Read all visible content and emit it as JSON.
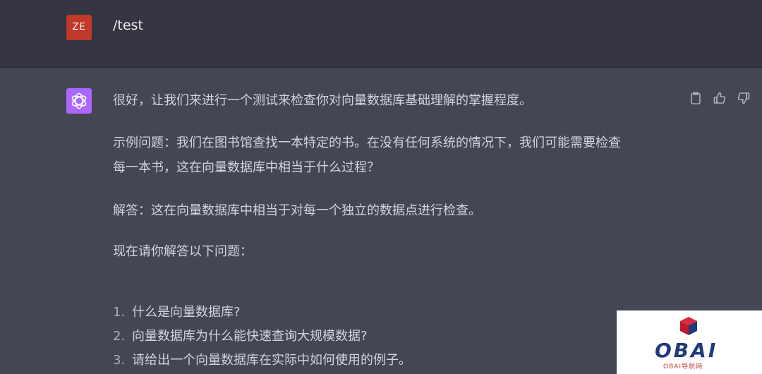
{
  "user_message": {
    "avatar_initials": "ZE",
    "avatar_color": "#c0392b",
    "text": "/test"
  },
  "assistant_message": {
    "avatar_icon": "openai-logo-icon",
    "avatar_color": "#ab68ff",
    "paragraphs": [
      "很好，让我们来进行一个测试来检查你对向量数据库基础理解的掌握程度。",
      "示例问题：我们在图书馆查找一本特定的书。在没有任何系统的情况下，我们可能需要检查\n每一本书，这在向量数据库中相当于什么过程？",
      "解答：这在向量数据库中相当于对每一个独立的数据点进行检查。",
      "现在请你解答以下问题："
    ],
    "list": [
      {
        "num": "1.",
        "text": "什么是向量数据库?"
      },
      {
        "num": "2.",
        "text": "向量数据库为什么能快速查询大规模数据?"
      },
      {
        "num": "3.",
        "text": "请给出一个向量数据库在实际中如何使用的例子。"
      }
    ],
    "actions": [
      "clipboard-icon",
      "thumbs-up-icon",
      "thumbs-down-icon"
    ]
  },
  "watermark": {
    "title": "OBAI",
    "subtitle": "OBAI导航网"
  },
  "colors": {
    "user_bg": "#343541",
    "assistant_bg": "#444654",
    "text": "#d1d5db"
  }
}
